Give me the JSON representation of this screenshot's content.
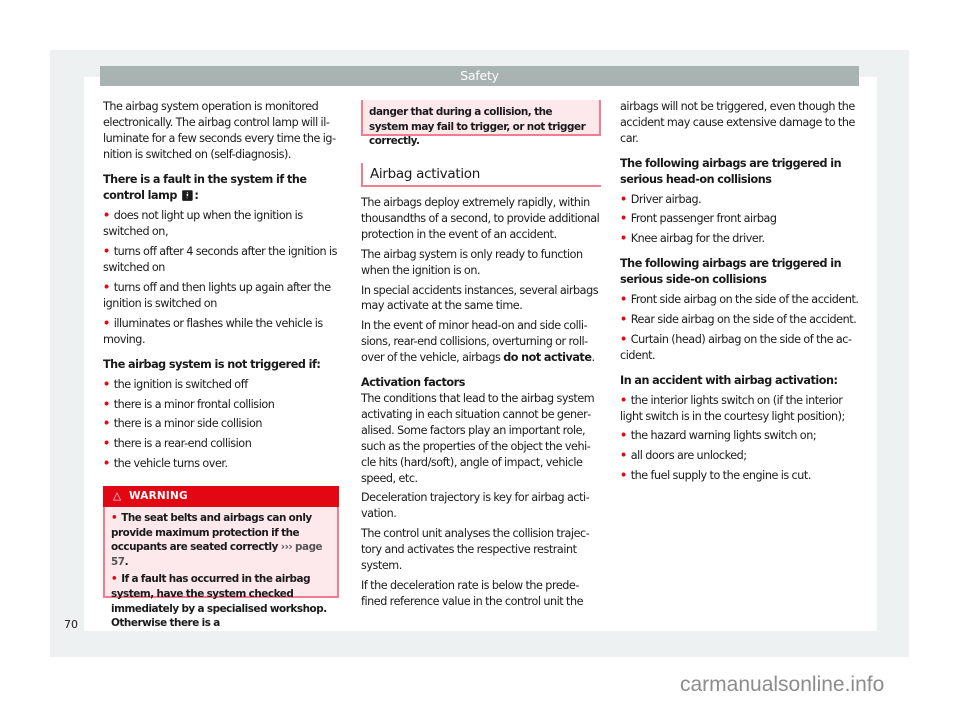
{
  "header": {
    "title": "Safety"
  },
  "column1": {
    "intro": "The airbag system operation is monitored electronically. The airbag control lamp will il­luminate for a few seconds every time the ig­nition is switched on (self-diagnosis).",
    "fault_heading_prefix": "There is a fault in the system if the control lamp",
    "fault_heading_suffix": ":",
    "fault_icon": "airbag-lamp-icon",
    "fault_items": [
      "does not light up when the ignition is switched on,",
      "turns off after 4 seconds after the ignition is switched on",
      "turns off and then lights up again after the ignition is switched on",
      "illuminates or flashes while the vehicle is moving."
    ],
    "not_triggered_heading": "The airbag system is not triggered if:",
    "not_triggered_items": [
      "the ignition is switched off",
      "there is a minor frontal collision",
      "there is a minor side collision",
      "there is a rear-end collision",
      "the vehicle turns over."
    ]
  },
  "warning": {
    "label": "WARNING",
    "icon": "warning-triangle-icon",
    "item1_text": "The seat belts and airbags can only provide maximum protection if the occupants are seated correctly",
    "item1_link_arrows": "›››",
    "item1_link": "page 57",
    "item1_end": ".",
    "item2_text": "If a fault has occurred in the airbag system, have the system checked immediately by a specialised workshop. Otherwise there is a",
    "continuation": "danger that during a collision, the system may fail to trigger, or not trigger correctly."
  },
  "column2": {
    "section_title": "Airbag activation",
    "p1": "The airbags deploy extremely rapidly, within thousandths of a second, to provide addi­tional protection in the event of an accident.",
    "p2": "The airbag system is only ready to function when the ignition is on.",
    "p3": "In special accidents instances, several air­bags may activate at the same time.",
    "p4_text": "In the event of minor head-on and side colli­sions, rear-end collisions, overturning or roll-over of the vehicle, airbags",
    "p4_bold": "do not activate",
    "p4_end": ".",
    "factors_heading": "Activation factors",
    "p5": "The conditions that lead to the airbag system activating in each situation cannot be gener­alised. Some factors play an important role, such as the properties of the object the vehi­cle hits (hard/soft), angle of impact, vehicle speed, etc.",
    "p6": "Deceleration trajectory is key for airbag acti­vation.",
    "p7": "The control unit analyses the collision trajec­tory and activates the respective restraint system.",
    "p8": "If the deceleration rate is below the prede­fined reference value in the control unit the"
  },
  "column3": {
    "p1": "airbags will not be triggered, even though the accident may cause extensive damage to the car.",
    "head_on_heading": "The following airbags are triggered in seri­ous head-on collisions",
    "head_on_items": [
      "Driver airbag.",
      "Front passenger front airbag",
      "Knee airbag for the driver."
    ],
    "side_on_heading": "The following airbags are triggered in seri­ous side-on collisions",
    "side_on_items": [
      "Front side airbag on the side of the acci­dent.",
      "Rear side airbag on the side of the acci­dent.",
      "Curtain (head) airbag on the side of the ac­cident."
    ],
    "activation_heading": "In an accident with airbag activation:",
    "activation_items": [
      "the interior lights switch on (if the interior light switch is in the courtesy light position);",
      "the hazard warning lights switch on;",
      "all doors are unlocked;",
      "the fuel supply to the engine is cut."
    ]
  },
  "footer": {
    "page_number": "70",
    "watermark": "carmanualsonline.info"
  },
  "colors": {
    "accent_red": "#e30613",
    "warning_bg": "#fde8ec",
    "warning_border": "#f27d90",
    "header_bar": "#a9b4b2",
    "outer_bg": "#eef1f2"
  }
}
